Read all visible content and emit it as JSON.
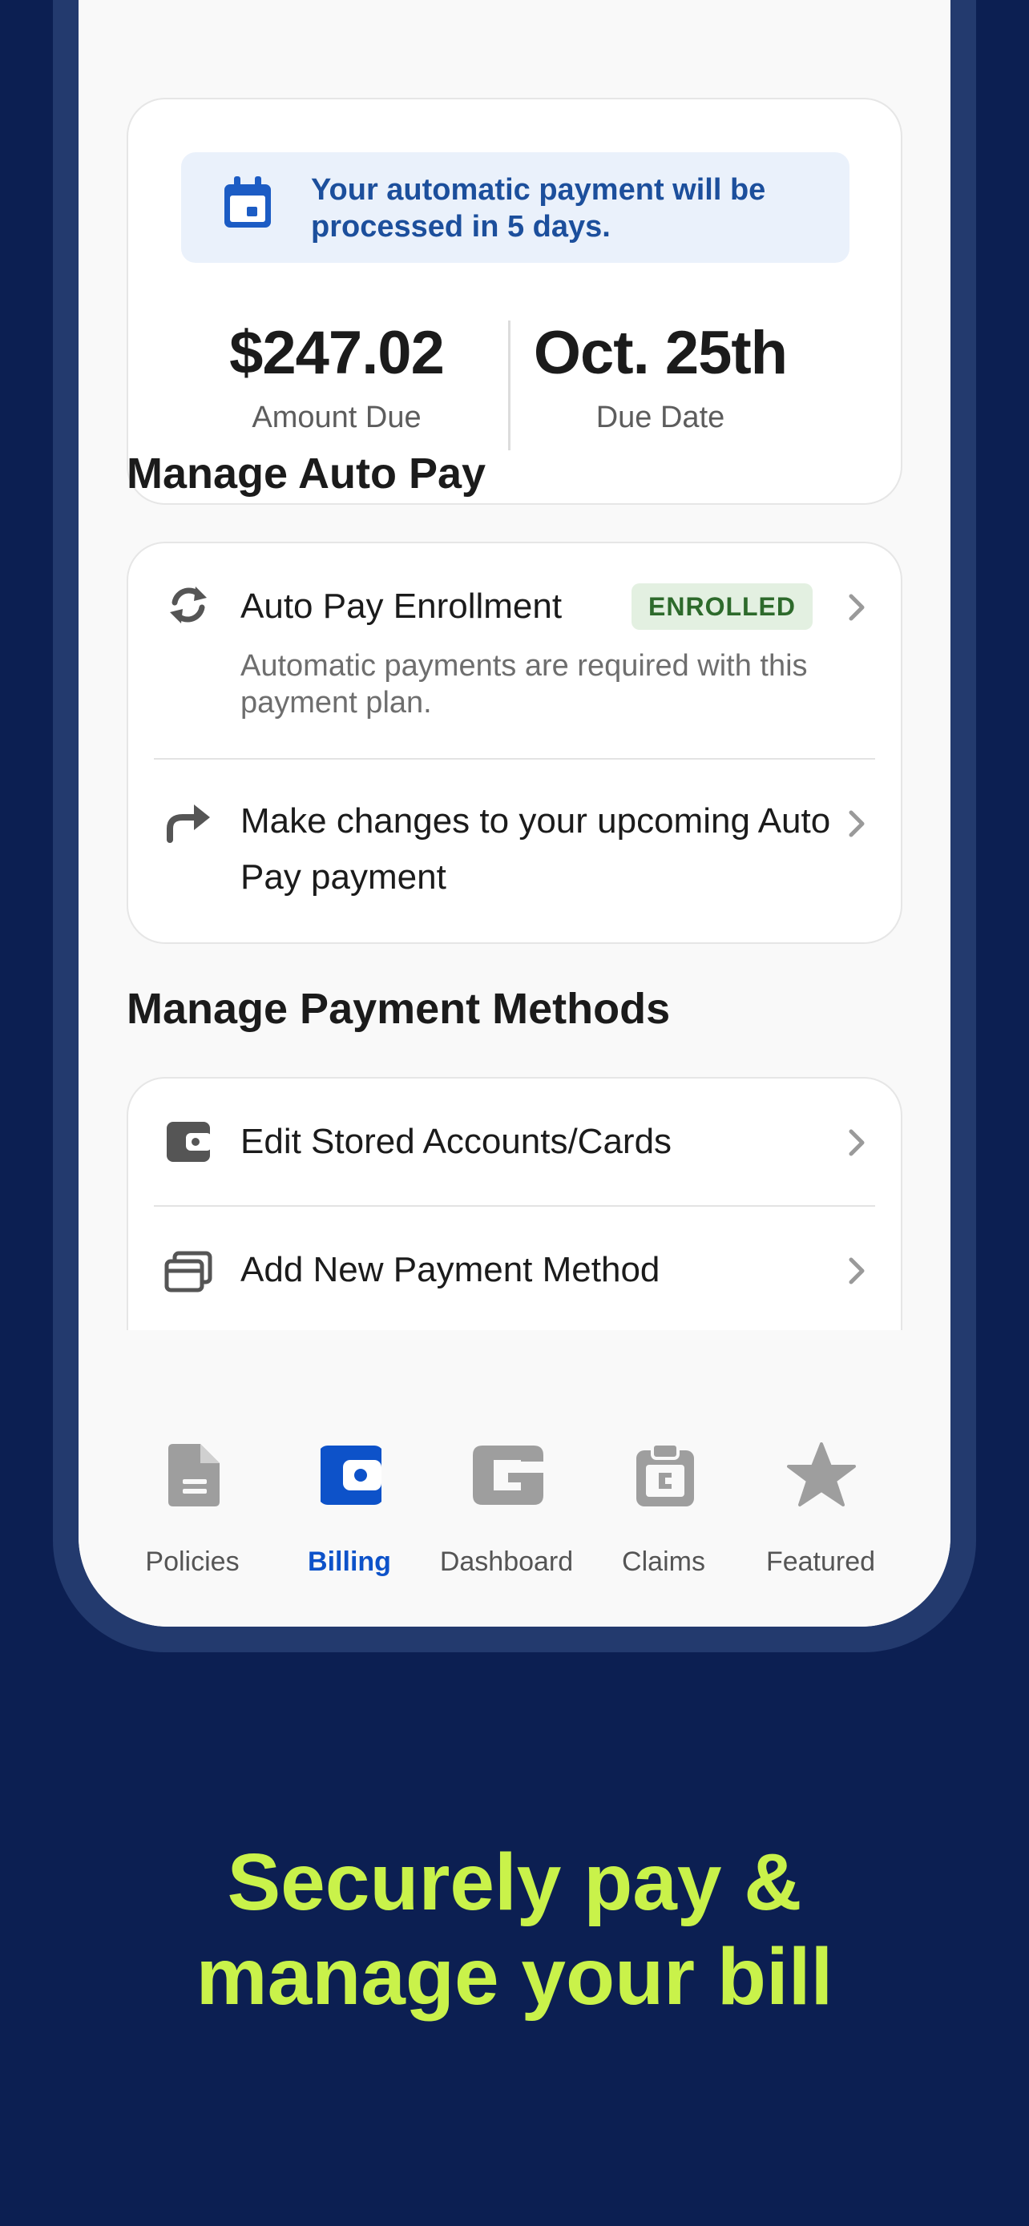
{
  "notice": {
    "text": "Your automatic payment will be processed in 5 days."
  },
  "summary": {
    "amount": "$247.02",
    "amount_label": "Amount Due",
    "date": "Oct. 25th",
    "date_label": "Due Date"
  },
  "autopay": {
    "title": "Manage Auto Pay",
    "enrollment": {
      "label": "Auto Pay Enrollment",
      "badge": "ENROLLED",
      "description": "Automatic payments are required with this payment plan."
    },
    "changes": {
      "label": "Make changes to your upcoming Auto Pay payment"
    }
  },
  "methods": {
    "title": "Manage Payment Methods",
    "items": [
      {
        "label": "Edit Stored Accounts/Cards"
      },
      {
        "label": "Add New Payment Method"
      }
    ]
  },
  "tabs": [
    {
      "label": "Policies",
      "active": false
    },
    {
      "label": "Billing",
      "active": true
    },
    {
      "label": "Dashboard",
      "active": false
    },
    {
      "label": "Claims",
      "active": false
    },
    {
      "label": "Featured",
      "active": false
    }
  ],
  "tagline": {
    "line1": "Securely pay &",
    "line2": "manage your bill"
  },
  "colors": {
    "background": "#0c1f52",
    "accent": "#0d52c9",
    "tagline": "#c9f24a",
    "badge_bg": "#e3f0e1",
    "badge_text": "#2d6a2b"
  }
}
